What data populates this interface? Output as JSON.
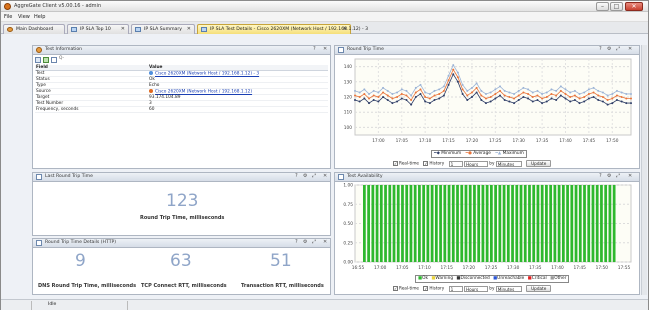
{
  "app": {
    "title": "AggreGate Client v5.00.16 - admin"
  },
  "window_controls": {
    "minimize": "–",
    "maximize": "□",
    "close": "✕"
  },
  "menu": [
    "File",
    "View",
    "Help"
  ],
  "tabs": [
    {
      "label": "Main Dashboard",
      "icon": "gear-icon",
      "close": ""
    },
    {
      "label": "IP SLA Top 10",
      "icon": "chart-icon",
      "close": "✕"
    },
    {
      "label": "IP SLA Summary",
      "icon": "chart-icon",
      "close": "✕"
    },
    {
      "label": "IP SLA Test Details - Cisco 2620XM (Network Host / 192.168.1.12) - 3",
      "icon": "chart-icon",
      "close": "✕",
      "active": true
    }
  ],
  "panel_controls": {
    "help": "?",
    "settings": "⚙",
    "zoom": "⤢",
    "close": "✕"
  },
  "test_info": {
    "title": "Test Information",
    "filter_placeholder": "Q-",
    "headers": {
      "field": "Field",
      "value": "Value"
    },
    "rows": [
      {
        "field": "Test",
        "value": "Cisco 2620XM (Network Host / 192.168.1.12) - 3",
        "link": true
      },
      {
        "field": "Status",
        "value": "Ok"
      },
      {
        "field": "Type",
        "value": "Echo"
      },
      {
        "field": "Source",
        "value": "Cisco 2620XM (Network Host / 192.168.1.12)",
        "link": true
      },
      {
        "field": "Target",
        "value": "93.174.104.89"
      },
      {
        "field": "Test Number",
        "value": "3"
      },
      {
        "field": "Frequency, seconds",
        "value": "60"
      }
    ]
  },
  "rtt_chart": {
    "title": "Round Trip Time",
    "legend": {
      "minimum": "Minimum",
      "average": "Average",
      "maximum": "Maximum"
    },
    "colors": {
      "minimum": "#2d3c66",
      "average": "#e8743b",
      "maximum": "#9bb3d6"
    },
    "controls": {
      "realtime": "Real-time",
      "history": "History",
      "amount": "1",
      "unit": "Hours",
      "by": "by",
      "by_unit": "Minutes",
      "update": "Update"
    }
  },
  "last_rtt": {
    "title": "Last Round Trip Time",
    "value": "123",
    "label": "Round Trip Time, milliseconds"
  },
  "rtt_details": {
    "title": "Round Trip Time Details (HTTP)",
    "items": [
      {
        "value": "9",
        "label": "DNS Round Trip Time, milliseconds"
      },
      {
        "value": "63",
        "label": "TCP Connect RTT, milliseconds"
      },
      {
        "value": "51",
        "label": "Transaction RTT, milliseconds"
      }
    ]
  },
  "availability": {
    "title": "Test Availability",
    "legend": [
      {
        "label": "Ok",
        "color": "#2eb82e"
      },
      {
        "label": "Warning",
        "color": "#f2e45a"
      },
      {
        "label": "Disconnected",
        "color": "#333333"
      },
      {
        "label": "Unreachable",
        "color": "#2b55d6"
      },
      {
        "label": "Critical",
        "color": "#e02020"
      },
      {
        "label": "Other",
        "color": "#9a9a9a"
      }
    ],
    "controls": {
      "realtime": "Real-time",
      "history": "History",
      "amount": "1",
      "unit": "Hours",
      "by": "by",
      "by_unit": "Minutes",
      "update": "Update"
    }
  },
  "status": {
    "text": "Idle"
  },
  "chart_data": [
    {
      "type": "line",
      "title": "",
      "x": [
        "16:55",
        "16:56",
        "16:57",
        "16:58",
        "16:59",
        "17:00",
        "17:01",
        "17:02",
        "17:03",
        "17:04",
        "17:05",
        "17:06",
        "17:07",
        "17:08",
        "17:09",
        "17:10",
        "17:11",
        "17:12",
        "17:13",
        "17:14",
        "17:15",
        "17:16",
        "17:17",
        "17:18",
        "17:19",
        "17:20",
        "17:21",
        "17:22",
        "17:23",
        "17:24",
        "17:25",
        "17:26",
        "17:27",
        "17:28",
        "17:29",
        "17:30",
        "17:31",
        "17:32",
        "17:33",
        "17:34",
        "17:35",
        "17:36",
        "17:37",
        "17:38",
        "17:39",
        "17:40",
        "17:41",
        "17:42",
        "17:43",
        "17:44",
        "17:45",
        "17:46",
        "17:47",
        "17:48",
        "17:49",
        "17:50",
        "17:51",
        "17:52",
        "17:53",
        "17:54"
      ],
      "x_ticks": [
        "17:00",
        "17:05",
        "17:10",
        "17:15",
        "17:20",
        "17:25",
        "17:30",
        "17:35",
        "17:40",
        "17:45",
        "17:50"
      ],
      "ylim": [
        95,
        145
      ],
      "y_ticks": [
        100,
        110,
        120,
        130,
        140
      ],
      "series": [
        {
          "name": "Minimum",
          "values": [
            118,
            117,
            119,
            116,
            118,
            117,
            120,
            118,
            116,
            117,
            119,
            118,
            115,
            120,
            122,
            117,
            116,
            118,
            119,
            121,
            128,
            135,
            130,
            122,
            118,
            120,
            123,
            118,
            116,
            117,
            119,
            121,
            118,
            117,
            116,
            118,
            120,
            119,
            117,
            118,
            116,
            117,
            119,
            118,
            121,
            119,
            117,
            118,
            116,
            117,
            119,
            120,
            118,
            117,
            115,
            116,
            118,
            117,
            116,
            116
          ]
        },
        {
          "name": "Average",
          "values": [
            121,
            120,
            122,
            119,
            121,
            120,
            123,
            121,
            119,
            120,
            122,
            121,
            118,
            123,
            125,
            120,
            119,
            121,
            122,
            124,
            131,
            138,
            133,
            125,
            121,
            123,
            126,
            121,
            119,
            120,
            122,
            124,
            121,
            120,
            119,
            121,
            123,
            122,
            120,
            121,
            119,
            120,
            122,
            121,
            124,
            122,
            120,
            121,
            119,
            120,
            122,
            123,
            121,
            120,
            118,
            119,
            121,
            120,
            119,
            119
          ]
        },
        {
          "name": "Maximum",
          "values": [
            124,
            123,
            125,
            122,
            124,
            123,
            126,
            124,
            122,
            123,
            125,
            124,
            121,
            126,
            128,
            123,
            122,
            124,
            125,
            127,
            134,
            141,
            136,
            128,
            124,
            126,
            129,
            124,
            122,
            123,
            125,
            127,
            124,
            123,
            122,
            124,
            126,
            125,
            123,
            124,
            122,
            123,
            125,
            124,
            127,
            125,
            123,
            124,
            122,
            123,
            125,
            126,
            124,
            123,
            121,
            122,
            124,
            123,
            122,
            122
          ]
        }
      ],
      "grid": true,
      "legend_position": "bottom"
    },
    {
      "type": "bar",
      "title": "",
      "x_ticks": [
        "16:55",
        "17:00",
        "17:05",
        "17:10",
        "17:15",
        "17:20",
        "17:25",
        "17:30",
        "17:35",
        "17:40",
        "17:45",
        "17:50",
        "17:55"
      ],
      "ylim": [
        0,
        1
      ],
      "y_ticks": [
        "0.00",
        "0.25",
        "0.50",
        "0.75",
        "1.00"
      ],
      "bar_count": 60,
      "series": [
        {
          "name": "Ok",
          "value_each": 1.0
        }
      ],
      "grid": true,
      "legend_position": "bottom"
    }
  ]
}
